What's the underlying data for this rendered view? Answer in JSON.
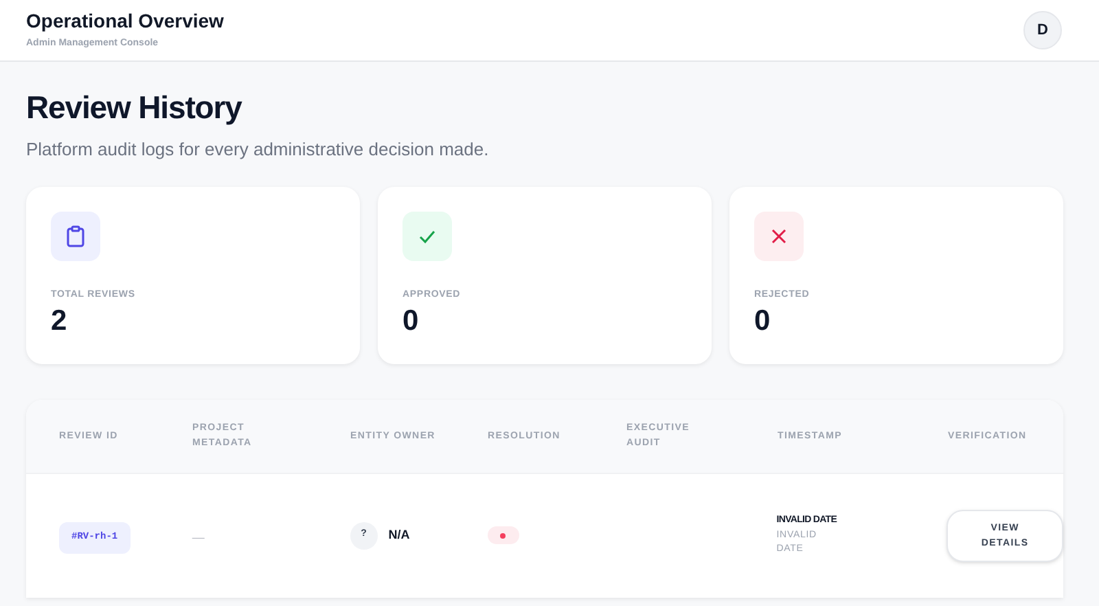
{
  "header": {
    "title": "Operational Overview",
    "subtitle": "Admin Management Console",
    "avatar": "D"
  },
  "page": {
    "title": "Review History",
    "subtitle": "Platform audit logs for every administrative decision made."
  },
  "stats": [
    {
      "kind": "total",
      "label": "TOTAL REVIEWS",
      "value": "2"
    },
    {
      "kind": "approved",
      "label": "APPROVED",
      "value": "0"
    },
    {
      "kind": "rejected",
      "label": "REJECTED",
      "value": "0"
    }
  ],
  "table": {
    "columns": [
      "REVIEW ID",
      "PROJECT METADATA",
      "ENTITY OWNER",
      "RESOLUTION",
      "EXECUTIVE AUDIT",
      "TIMESTAMP",
      "VERIFICATION"
    ],
    "rows": [
      {
        "review_id": "#RV-rh-1",
        "project_metadata": "—",
        "owner_initial": "?",
        "owner": "N/A",
        "resolution": {
          "color": "#f43f5e"
        },
        "timestamp": "INVALID DATE",
        "timestamp_sub": "INVALID DATE",
        "action": "VIEW DETAILS"
      }
    ]
  }
}
